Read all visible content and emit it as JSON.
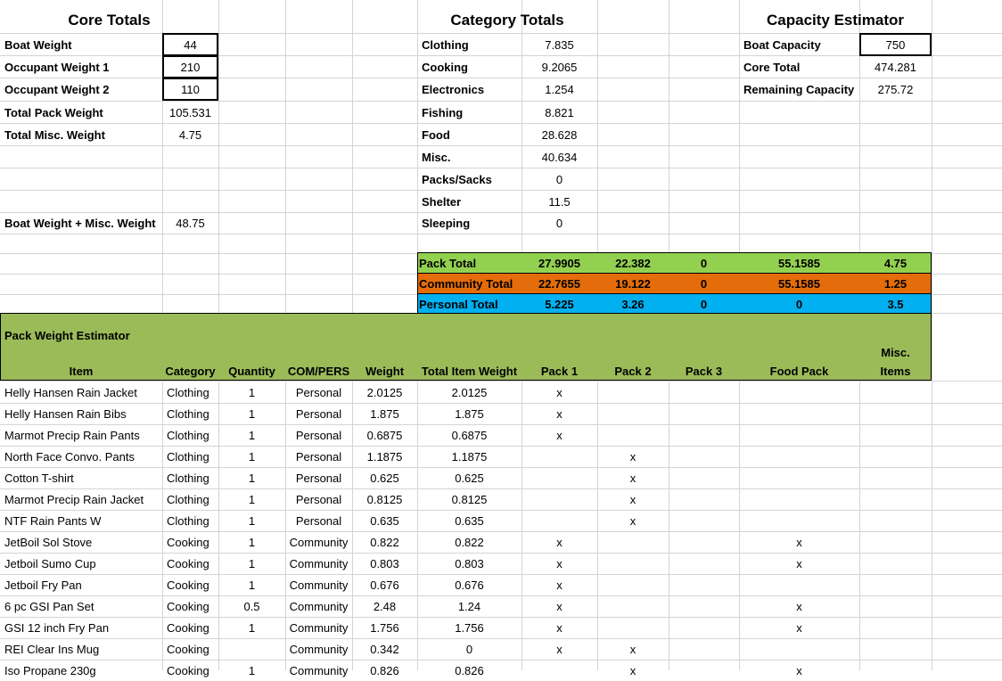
{
  "colors": {
    "pack_total_bg": "#92d050",
    "community_total_bg": "#e46c0a",
    "personal_total_bg": "#00b0f0",
    "estimator_header_bg": "#9bbb59",
    "gridline": "#d4d4d4"
  },
  "core_totals": {
    "title": "Core Totals",
    "rows": [
      {
        "label": "Boat Weight",
        "value": "44"
      },
      {
        "label": "Occupant Weight 1",
        "value": "210"
      },
      {
        "label": "Occupant Weight 2",
        "value": "110"
      },
      {
        "label": "Total Pack Weight",
        "value": "105.531"
      },
      {
        "label": "Total Misc. Weight",
        "value": "4.75"
      }
    ],
    "boat_plus_misc": {
      "label": "Boat Weight + Misc. Weight",
      "value": "48.75"
    }
  },
  "category_totals": {
    "title": "Category Totals",
    "rows": [
      {
        "label": "Clothing",
        "value": "7.835"
      },
      {
        "label": "Cooking",
        "value": "9.2065"
      },
      {
        "label": "Electronics",
        "value": "1.254"
      },
      {
        "label": "Fishing",
        "value": "8.821"
      },
      {
        "label": "Food",
        "value": "28.628"
      },
      {
        "label": "Misc.",
        "value": "40.634"
      },
      {
        "label": "Packs/Sacks",
        "value": "0"
      },
      {
        "label": "Shelter",
        "value": "11.5"
      },
      {
        "label": "Sleeping",
        "value": "0"
      }
    ]
  },
  "capacity_estimator": {
    "title": "Capacity Estimator",
    "rows": [
      {
        "label": "Boat Capacity",
        "value": "750"
      },
      {
        "label": "Core Total",
        "value": "474.281"
      },
      {
        "label": "Remaining Capacity",
        "value": "275.72"
      }
    ]
  },
  "totals_bands": [
    {
      "label": "Pack Total",
      "values": [
        "27.9905",
        "22.382",
        "0",
        "55.1585",
        "4.75"
      ]
    },
    {
      "label": "Community Total",
      "values": [
        "22.7655",
        "19.122",
        "0",
        "55.1585",
        "1.25"
      ]
    },
    {
      "label": "Personal Total",
      "values": [
        "5.225",
        "3.26",
        "0",
        "0",
        "3.5"
      ]
    }
  ],
  "pack_weight_estimator": {
    "title": "Pack Weight Estimator",
    "misc_label_line1": "Misc.",
    "columns": [
      "Item",
      "Category",
      "Quantity",
      "COM/PERS",
      "Weight",
      "Total Item Weight",
      "Pack 1",
      "Pack 2",
      "Pack 3",
      "Food Pack",
      "Items"
    ],
    "rows": [
      {
        "item": "Helly Hansen Rain Jacket",
        "category": "Clothing",
        "qty": "1",
        "compers": "Personal",
        "weight": "2.0125",
        "total": "2.0125",
        "p1": "x",
        "p2": "",
        "p3": "",
        "food": "",
        "misc": ""
      },
      {
        "item": "Helly Hansen Rain Bibs",
        "category": "Clothing",
        "qty": "1",
        "compers": "Personal",
        "weight": "1.875",
        "total": "1.875",
        "p1": "x",
        "p2": "",
        "p3": "",
        "food": "",
        "misc": ""
      },
      {
        "item": "Marmot Precip Rain Pants",
        "category": "Clothing",
        "qty": "1",
        "compers": "Personal",
        "weight": "0.6875",
        "total": "0.6875",
        "p1": "x",
        "p2": "",
        "p3": "",
        "food": "",
        "misc": ""
      },
      {
        "item": "North Face Convo. Pants",
        "category": "Clothing",
        "qty": "1",
        "compers": "Personal",
        "weight": "1.1875",
        "total": "1.1875",
        "p1": "",
        "p2": "x",
        "p3": "",
        "food": "",
        "misc": ""
      },
      {
        "item": "Cotton T-shirt",
        "category": "Clothing",
        "qty": "1",
        "compers": "Personal",
        "weight": "0.625",
        "total": "0.625",
        "p1": "",
        "p2": "x",
        "p3": "",
        "food": "",
        "misc": ""
      },
      {
        "item": "Marmot Precip Rain Jacket",
        "category": "Clothing",
        "qty": "1",
        "compers": "Personal",
        "weight": "0.8125",
        "total": "0.8125",
        "p1": "",
        "p2": "x",
        "p3": "",
        "food": "",
        "misc": ""
      },
      {
        "item": "NTF Rain Pants W",
        "category": "Clothing",
        "qty": "1",
        "compers": "Personal",
        "weight": "0.635",
        "total": "0.635",
        "p1": "",
        "p2": "x",
        "p3": "",
        "food": "",
        "misc": ""
      },
      {
        "item": "JetBoil Sol Stove",
        "category": "Cooking",
        "qty": "1",
        "compers": "Community",
        "weight": "0.822",
        "total": "0.822",
        "p1": "x",
        "p2": "",
        "p3": "",
        "food": "x",
        "misc": ""
      },
      {
        "item": "Jetboil Sumo Cup",
        "category": "Cooking",
        "qty": "1",
        "compers": "Community",
        "weight": "0.803",
        "total": "0.803",
        "p1": "x",
        "p2": "",
        "p3": "",
        "food": "x",
        "misc": ""
      },
      {
        "item": "Jetboil Fry Pan",
        "category": "Cooking",
        "qty": "1",
        "compers": "Community",
        "weight": "0.676",
        "total": "0.676",
        "p1": "x",
        "p2": "",
        "p3": "",
        "food": "",
        "misc": ""
      },
      {
        "item": "6 pc GSI Pan Set",
        "category": "Cooking",
        "qty": "0.5",
        "compers": "Community",
        "weight": "2.48",
        "total": "1.24",
        "p1": "x",
        "p2": "",
        "p3": "",
        "food": "x",
        "misc": ""
      },
      {
        "item": "GSI 12 inch Fry Pan",
        "category": "Cooking",
        "qty": "1",
        "compers": "Community",
        "weight": "1.756",
        "total": "1.756",
        "p1": "x",
        "p2": "",
        "p3": "",
        "food": "x",
        "misc": ""
      },
      {
        "item": "REI Clear Ins Mug",
        "category": "Cooking",
        "qty": "",
        "compers": "Community",
        "weight": "0.342",
        "total": "0",
        "p1": "x",
        "p2": "x",
        "p3": "",
        "food": "",
        "misc": ""
      },
      {
        "item": "Iso Propane 230g",
        "category": "Cooking",
        "qty": "1",
        "compers": "Community",
        "weight": "0.826",
        "total": "0.826",
        "p1": "",
        "p2": "x",
        "p3": "",
        "food": "x",
        "misc": ""
      }
    ]
  }
}
